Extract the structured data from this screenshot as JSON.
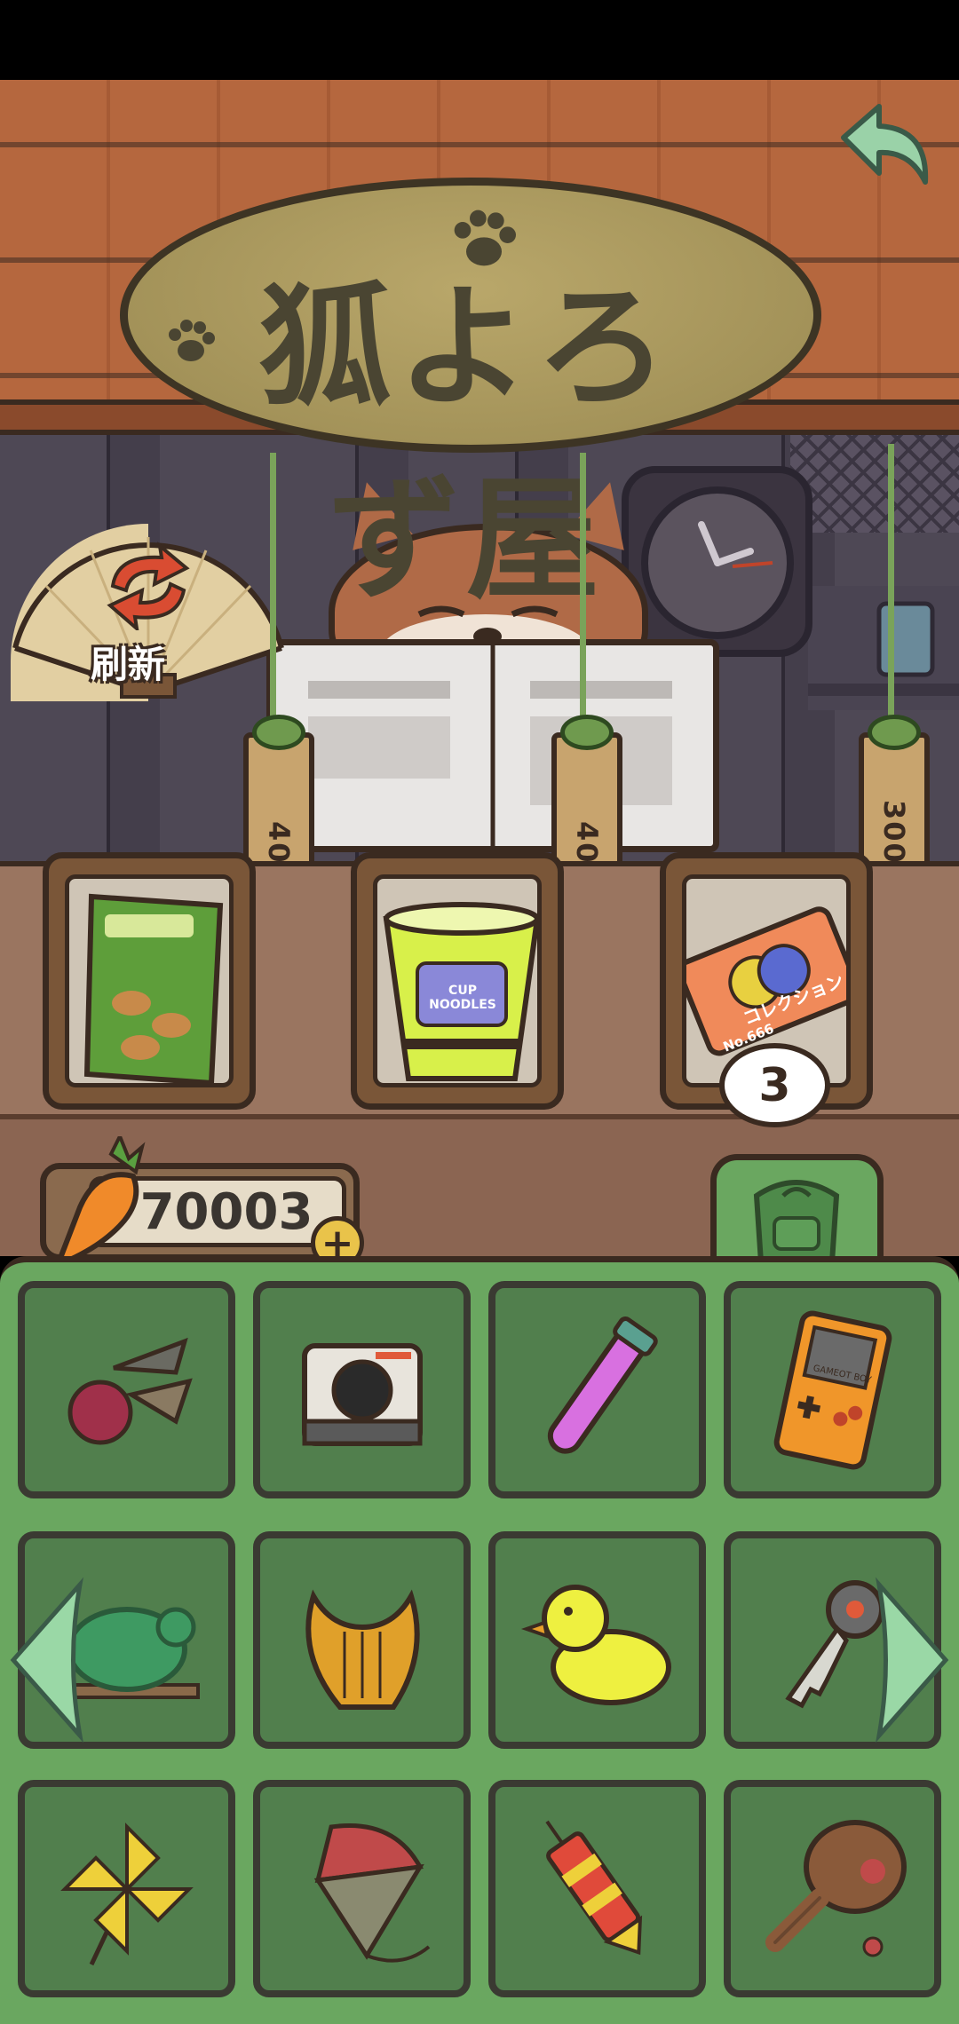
{
  "shop": {
    "sign_title": "狐よろず屋",
    "refresh_label": "刷新",
    "items": [
      {
        "name": "Snack bag",
        "price": "40",
        "icon": "snack-bag-icon"
      },
      {
        "name": "Cup Noodle",
        "price": "40",
        "icon": "cup-noodle-icon"
      },
      {
        "name": "Collection ticket",
        "price": "300",
        "icon": "ticket-icon"
      }
    ],
    "ticket_count": "3",
    "cup_label": "CUP NOODLES",
    "ticket_label": "コレクション",
    "ticket_number": "No.666"
  },
  "currency": {
    "amount": "70003",
    "add_symbol": "+"
  },
  "inventory": {
    "slots": [
      {
        "icon": "castanets-icon"
      },
      {
        "icon": "instant-camera-icon"
      },
      {
        "icon": "potion-tube-icon"
      },
      {
        "icon": "handheld-console-icon"
      },
      {
        "icon": "frog-figure-icon"
      },
      {
        "icon": "lyre-icon"
      },
      {
        "icon": "rubber-duck-icon"
      },
      {
        "icon": "key-icon"
      },
      {
        "icon": "pinwheel-icon"
      },
      {
        "icon": "spinning-top-icon"
      },
      {
        "icon": "rocket-firework-icon"
      },
      {
        "icon": "paddle-toy-icon"
      }
    ],
    "console_label": "GAMEOT BOY"
  },
  "colors": {
    "panel_green": "#6aa760",
    "slot_green": "#517f4d",
    "roof": "#b5673e",
    "counter": "#9a7560"
  }
}
